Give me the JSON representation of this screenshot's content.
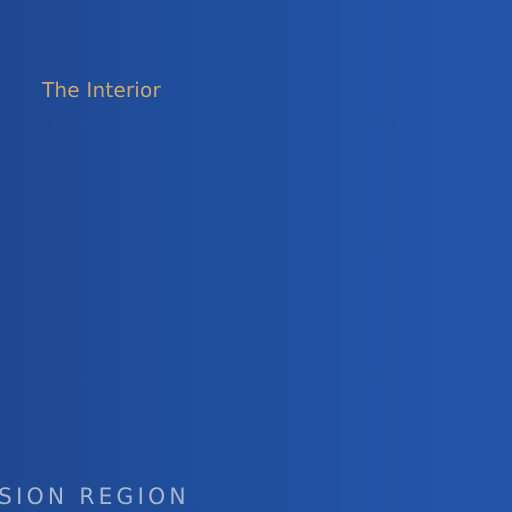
{
  "top_label": "The Interior",
  "bottom_label": "SION REGION",
  "colors": {
    "background_left": "#1f4890",
    "background_right": "#2455aa",
    "top_label_color": "#c9a96e",
    "bottom_label_color": "#a7b6cf"
  }
}
